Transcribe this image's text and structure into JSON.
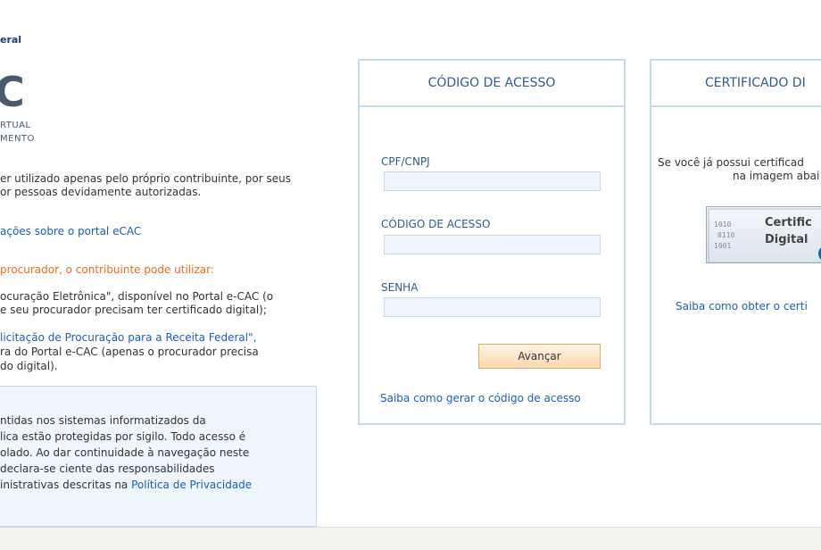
{
  "brand": {
    "label": "eral"
  },
  "logo": {
    "big": "C",
    "sub1": "RTUAL",
    "sub2": "MENTO"
  },
  "intro": {
    "line1": "er utilizado apenas pelo próprio contribuinte, por seus",
    "line2": "or pessoas devidamente autorizadas."
  },
  "info_link": "ações sobre o portal eCAC",
  "procurador_heading": "procurador, o contribuinte pode utilizar:",
  "option1": {
    "line1": "ocuração Eletrônica\", disponível no Portal e-CAC (o",
    "line2": "e seu procurador precisam ter certificado digital);"
  },
  "option2": {
    "line1_link": "licitação de Procuração para a Receita Federal\",",
    "line2": "ra do Portal e-CAC (apenas o procurador precisa",
    "line3": "do digital)."
  },
  "notice": {
    "line1": "ntidas nos sistemas informatizados da",
    "line2": "lica estão protegidas por sigilo. Todo acesso é",
    "line3": "olado. Ao dar continuidade à navegação neste",
    "line4": "declara-se ciente das responsabilidades",
    "line5_prefix": "inistrativas descritas na ",
    "line5_link": "Política de Privacidade"
  },
  "codigo_panel": {
    "title": "CÓDIGO DE ACESSO",
    "fields": [
      {
        "label": "CPF/CNPJ",
        "value": ""
      },
      {
        "label": "CÓDIGO DE ACESSO",
        "value": ""
      },
      {
        "label": "SENHA",
        "value": ""
      }
    ],
    "submit_label": "Avançar",
    "help_link": "Saiba como gerar o código de acesso"
  },
  "certificado_panel": {
    "title": "CERTIFICADO DI",
    "text1": "Se você já possui certificad",
    "text2": "na imagem abai",
    "badge_line1": "Certific",
    "badge_line2": "Digital",
    "badge_code": "1010",
    "help_link": "Saiba como obter o certi"
  },
  "colors": {
    "link": "#1c5fb8",
    "orange": "#f26b1d",
    "panel_border": "#c5dbec",
    "panel_title": "#2d5c94",
    "button_bg": "#fbd9b0"
  }
}
